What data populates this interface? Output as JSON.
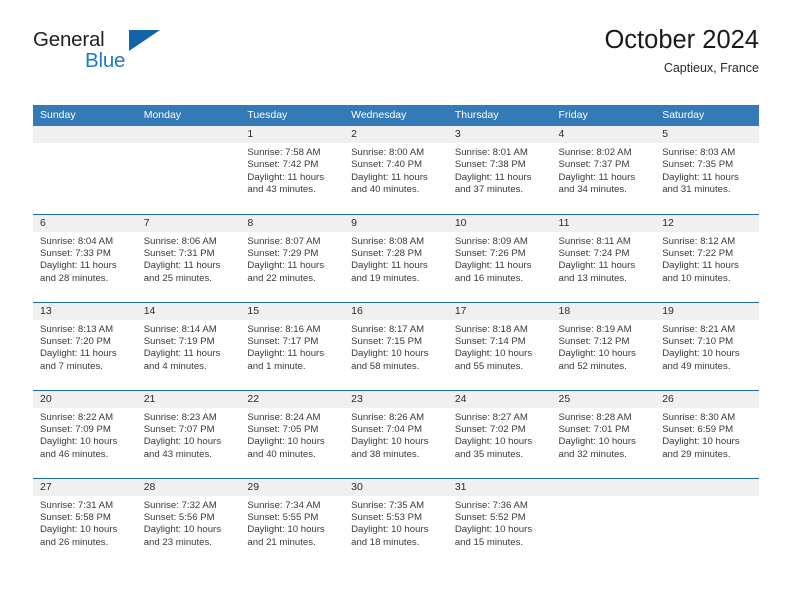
{
  "brand": {
    "name_part1": "General",
    "name_part2": "Blue",
    "triangle_color": "#1463a8",
    "blue_text_color": "#1f7ac4"
  },
  "header": {
    "title": "October 2024",
    "location": "Captieux, France",
    "header_bg_color": "#337ab7",
    "row_border_color": "#1f6cb0",
    "daynum_bg_color": "#f0f0f0"
  },
  "weekday_headers": [
    "Sunday",
    "Monday",
    "Tuesday",
    "Wednesday",
    "Thursday",
    "Friday",
    "Saturday"
  ],
  "labels": {
    "sunrise_prefix": "Sunrise:",
    "sunset_prefix": "Sunset:",
    "daylight_prefix": "Daylight:"
  },
  "weeks": [
    [
      {
        "day": "",
        "empty": true
      },
      {
        "day": "",
        "empty": true
      },
      {
        "day": "1",
        "sunrise": "Sunrise: 7:58 AM",
        "sunset": "Sunset: 7:42 PM",
        "daylight_l1": "Daylight: 11 hours",
        "daylight_l2": "and 43 minutes."
      },
      {
        "day": "2",
        "sunrise": "Sunrise: 8:00 AM",
        "sunset": "Sunset: 7:40 PM",
        "daylight_l1": "Daylight: 11 hours",
        "daylight_l2": "and 40 minutes."
      },
      {
        "day": "3",
        "sunrise": "Sunrise: 8:01 AM",
        "sunset": "Sunset: 7:38 PM",
        "daylight_l1": "Daylight: 11 hours",
        "daylight_l2": "and 37 minutes."
      },
      {
        "day": "4",
        "sunrise": "Sunrise: 8:02 AM",
        "sunset": "Sunset: 7:37 PM",
        "daylight_l1": "Daylight: 11 hours",
        "daylight_l2": "and 34 minutes."
      },
      {
        "day": "5",
        "sunrise": "Sunrise: 8:03 AM",
        "sunset": "Sunset: 7:35 PM",
        "daylight_l1": "Daylight: 11 hours",
        "daylight_l2": "and 31 minutes."
      }
    ],
    [
      {
        "day": "6",
        "sunrise": "Sunrise: 8:04 AM",
        "sunset": "Sunset: 7:33 PM",
        "daylight_l1": "Daylight: 11 hours",
        "daylight_l2": "and 28 minutes."
      },
      {
        "day": "7",
        "sunrise": "Sunrise: 8:06 AM",
        "sunset": "Sunset: 7:31 PM",
        "daylight_l1": "Daylight: 11 hours",
        "daylight_l2": "and 25 minutes."
      },
      {
        "day": "8",
        "sunrise": "Sunrise: 8:07 AM",
        "sunset": "Sunset: 7:29 PM",
        "daylight_l1": "Daylight: 11 hours",
        "daylight_l2": "and 22 minutes."
      },
      {
        "day": "9",
        "sunrise": "Sunrise: 8:08 AM",
        "sunset": "Sunset: 7:28 PM",
        "daylight_l1": "Daylight: 11 hours",
        "daylight_l2": "and 19 minutes."
      },
      {
        "day": "10",
        "sunrise": "Sunrise: 8:09 AM",
        "sunset": "Sunset: 7:26 PM",
        "daylight_l1": "Daylight: 11 hours",
        "daylight_l2": "and 16 minutes."
      },
      {
        "day": "11",
        "sunrise": "Sunrise: 8:11 AM",
        "sunset": "Sunset: 7:24 PM",
        "daylight_l1": "Daylight: 11 hours",
        "daylight_l2": "and 13 minutes."
      },
      {
        "day": "12",
        "sunrise": "Sunrise: 8:12 AM",
        "sunset": "Sunset: 7:22 PM",
        "daylight_l1": "Daylight: 11 hours",
        "daylight_l2": "and 10 minutes."
      }
    ],
    [
      {
        "day": "13",
        "sunrise": "Sunrise: 8:13 AM",
        "sunset": "Sunset: 7:20 PM",
        "daylight_l1": "Daylight: 11 hours",
        "daylight_l2": "and 7 minutes."
      },
      {
        "day": "14",
        "sunrise": "Sunrise: 8:14 AM",
        "sunset": "Sunset: 7:19 PM",
        "daylight_l1": "Daylight: 11 hours",
        "daylight_l2": "and 4 minutes."
      },
      {
        "day": "15",
        "sunrise": "Sunrise: 8:16 AM",
        "sunset": "Sunset: 7:17 PM",
        "daylight_l1": "Daylight: 11 hours",
        "daylight_l2": "and 1 minute."
      },
      {
        "day": "16",
        "sunrise": "Sunrise: 8:17 AM",
        "sunset": "Sunset: 7:15 PM",
        "daylight_l1": "Daylight: 10 hours",
        "daylight_l2": "and 58 minutes."
      },
      {
        "day": "17",
        "sunrise": "Sunrise: 8:18 AM",
        "sunset": "Sunset: 7:14 PM",
        "daylight_l1": "Daylight: 10 hours",
        "daylight_l2": "and 55 minutes."
      },
      {
        "day": "18",
        "sunrise": "Sunrise: 8:19 AM",
        "sunset": "Sunset: 7:12 PM",
        "daylight_l1": "Daylight: 10 hours",
        "daylight_l2": "and 52 minutes."
      },
      {
        "day": "19",
        "sunrise": "Sunrise: 8:21 AM",
        "sunset": "Sunset: 7:10 PM",
        "daylight_l1": "Daylight: 10 hours",
        "daylight_l2": "and 49 minutes."
      }
    ],
    [
      {
        "day": "20",
        "sunrise": "Sunrise: 8:22 AM",
        "sunset": "Sunset: 7:09 PM",
        "daylight_l1": "Daylight: 10 hours",
        "daylight_l2": "and 46 minutes."
      },
      {
        "day": "21",
        "sunrise": "Sunrise: 8:23 AM",
        "sunset": "Sunset: 7:07 PM",
        "daylight_l1": "Daylight: 10 hours",
        "daylight_l2": "and 43 minutes."
      },
      {
        "day": "22",
        "sunrise": "Sunrise: 8:24 AM",
        "sunset": "Sunset: 7:05 PM",
        "daylight_l1": "Daylight: 10 hours",
        "daylight_l2": "and 40 minutes."
      },
      {
        "day": "23",
        "sunrise": "Sunrise: 8:26 AM",
        "sunset": "Sunset: 7:04 PM",
        "daylight_l1": "Daylight: 10 hours",
        "daylight_l2": "and 38 minutes."
      },
      {
        "day": "24",
        "sunrise": "Sunrise: 8:27 AM",
        "sunset": "Sunset: 7:02 PM",
        "daylight_l1": "Daylight: 10 hours",
        "daylight_l2": "and 35 minutes."
      },
      {
        "day": "25",
        "sunrise": "Sunrise: 8:28 AM",
        "sunset": "Sunset: 7:01 PM",
        "daylight_l1": "Daylight: 10 hours",
        "daylight_l2": "and 32 minutes."
      },
      {
        "day": "26",
        "sunrise": "Sunrise: 8:30 AM",
        "sunset": "Sunset: 6:59 PM",
        "daylight_l1": "Daylight: 10 hours",
        "daylight_l2": "and 29 minutes."
      }
    ],
    [
      {
        "day": "27",
        "sunrise": "Sunrise: 7:31 AM",
        "sunset": "Sunset: 5:58 PM",
        "daylight_l1": "Daylight: 10 hours",
        "daylight_l2": "and 26 minutes."
      },
      {
        "day": "28",
        "sunrise": "Sunrise: 7:32 AM",
        "sunset": "Sunset: 5:56 PM",
        "daylight_l1": "Daylight: 10 hours",
        "daylight_l2": "and 23 minutes."
      },
      {
        "day": "29",
        "sunrise": "Sunrise: 7:34 AM",
        "sunset": "Sunset: 5:55 PM",
        "daylight_l1": "Daylight: 10 hours",
        "daylight_l2": "and 21 minutes."
      },
      {
        "day": "30",
        "sunrise": "Sunrise: 7:35 AM",
        "sunset": "Sunset: 5:53 PM",
        "daylight_l1": "Daylight: 10 hours",
        "daylight_l2": "and 18 minutes."
      },
      {
        "day": "31",
        "sunrise": "Sunrise: 7:36 AM",
        "sunset": "Sunset: 5:52 PM",
        "daylight_l1": "Daylight: 10 hours",
        "daylight_l2": "and 15 minutes."
      },
      {
        "day": "",
        "empty": true
      },
      {
        "day": "",
        "empty": true
      }
    ]
  ]
}
